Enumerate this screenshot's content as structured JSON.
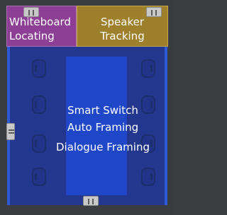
{
  "zones": {
    "whiteboard": {
      "line1": "Whiteboard",
      "line2": "Locating",
      "color": "#8c3f94"
    },
    "speaker": {
      "line1": "Speaker",
      "line2": "Tracking",
      "color": "#9d7f2c"
    }
  },
  "room": {
    "color": "#23378e",
    "modes": [
      "Smart Switch",
      "Auto Framing",
      "Dialogue Framing"
    ]
  },
  "icons": [
    "resize-handle-icon"
  ]
}
